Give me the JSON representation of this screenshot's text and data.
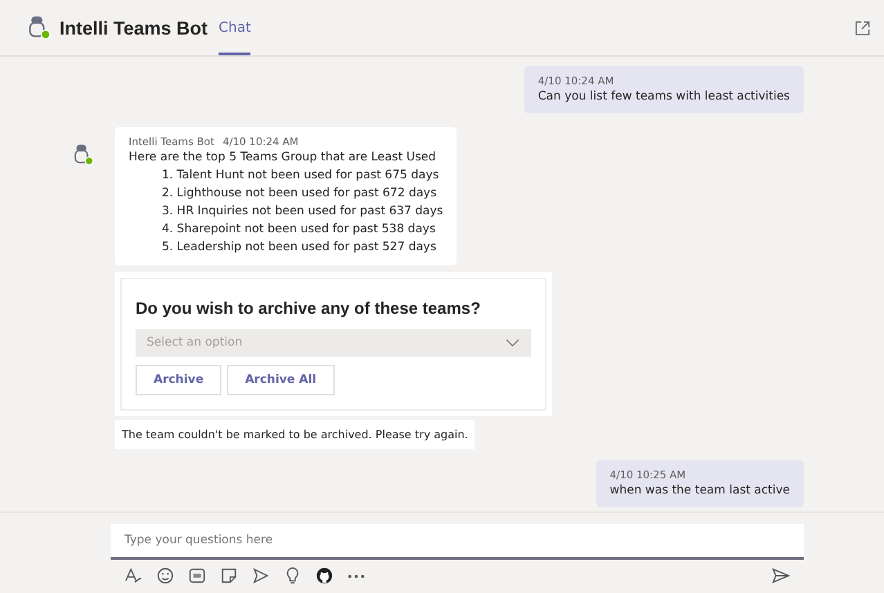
{
  "header": {
    "title": "Intelli Teams Bot",
    "tabs": [
      {
        "label": "Chat",
        "selected": true
      }
    ]
  },
  "messages": [
    {
      "kind": "user",
      "time": "4/10 10:24 AM",
      "text": "Can you list few teams with least activities"
    },
    {
      "kind": "bot",
      "sender": "Intelli Teams Bot",
      "time": "4/10 10:24 AM",
      "intro": "Here are the top 5 Teams Group that are Least Used",
      "items": [
        "1. Talent Hunt not been used for past 675 days",
        "2. Lighthouse not been used for past 672 days",
        "3. HR Inquiries not been used for past 637 days",
        "4. Sharepoint not been used for past 538 days",
        "5. Leadership not been used for past 527 days"
      ]
    },
    {
      "kind": "card",
      "question": "Do you wish to archive any of these teams?",
      "select_placeholder": "Select an option",
      "buttons": [
        "Archive",
        "Archive All"
      ]
    },
    {
      "kind": "notice",
      "text": "The team couldn't be marked to be archived. Please try again."
    },
    {
      "kind": "user",
      "time": "4/10 10:25 AM",
      "text": "when was the team last active"
    }
  ],
  "compose": {
    "placeholder": "Type your questions here"
  }
}
